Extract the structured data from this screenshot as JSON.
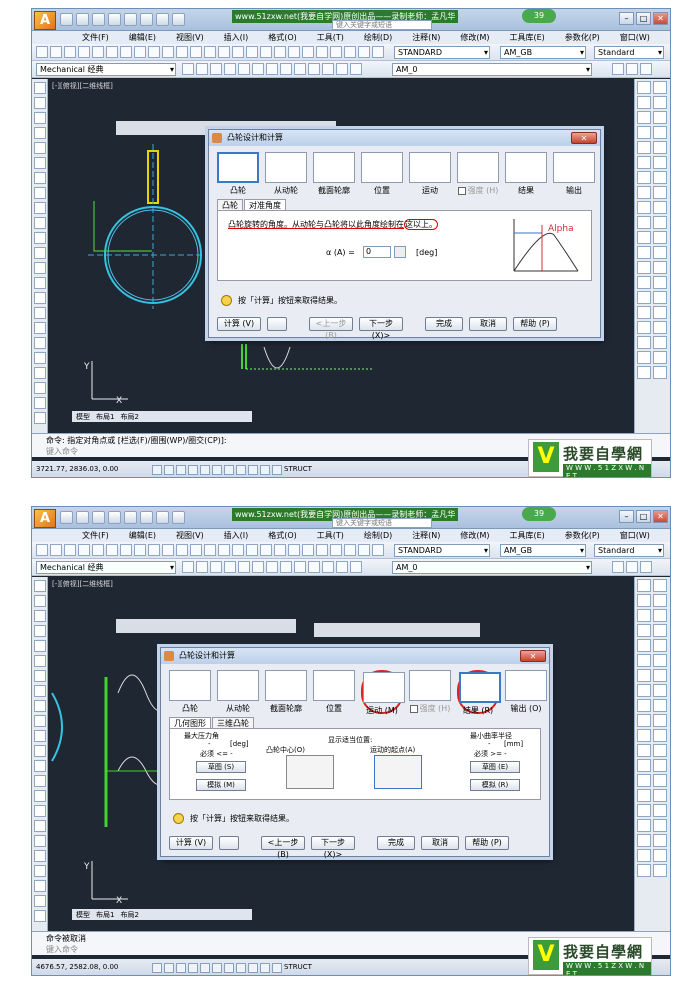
{
  "app": {
    "title_watermark": "www.51zxw.net(我要自学网)原创出品——录制老师：孟凡华",
    "search_placeholder": "键入关键字或短语",
    "badge": "39",
    "help": "?",
    "menu": [
      "文件(F)",
      "编辑(E)",
      "视图(V)",
      "插入(I)",
      "格式(O)",
      "工具(T)",
      "绘制(D)",
      "注释(N)",
      "修改(M)",
      "工具库(E)",
      "参数化(P)",
      "窗口(W)"
    ],
    "style_combo": "STANDARD",
    "dim_combo": "AM_GB",
    "table_combo": "Standard",
    "workspace": "Mechanical 经典",
    "layer": "AM_0",
    "viewport_label": "[-][俯视][二维线框]",
    "layout_tabs": [
      "模型",
      "布局1",
      "布局2"
    ],
    "status_snap": "STRUCT",
    "brand_name": "我要自學網",
    "brand_url": "W W W . 5 1 Z X W . N E T"
  },
  "shot1": {
    "command": "命令: 指定对角点或 [栏选(F)/圈围(WP)/圈交(CP)]:",
    "prompt": "键入命令",
    "coords": "3721.77, 2836.03, 0.00",
    "graph_label": "Alpha"
  },
  "shot2": {
    "command": "命令被取消",
    "prompt": "键入命令",
    "coords": "4676.57, 2582.08, 0.00"
  },
  "dialog": {
    "title": "凸轮设计和计算",
    "close": "✕",
    "wizard": [
      "凸轮",
      "从动轮",
      "截面轮廓",
      "位置",
      "运动",
      "强度 (H)",
      "结果",
      "输出"
    ],
    "wizard_shot2": [
      "凸轮",
      "从动轮",
      "截面轮廓",
      "位置",
      "运动 (M)",
      "强度 (H)",
      "结果 (R)",
      "输出 (O)"
    ],
    "hint": "按「计算」按钮来取得结果。",
    "buttons": [
      "计算 (V)",
      "<上一步 (B)",
      "下一步 (X)>",
      "完成",
      "取消",
      "帮助 (P)"
    ],
    "buttons_shot2": [
      "计算 (V)",
      "<上一步 (B)",
      "下一步 (X)>",
      "完成",
      "取消",
      "帮助 (P)"
    ],
    "shot1_tabs": [
      "凸轮",
      "对准角度"
    ],
    "shot1_desc_a": "凸轮旋转的角度。",
    "shot1_desc_b": "从动轮与凸轮将以此角度绘制在",
    "shot1_desc_c": "这以上。",
    "alpha_label": "α (A) =",
    "alpha_value": "0",
    "alpha_unit": "[deg]",
    "shot2_tabs": [
      "几何图形",
      "三维凸轮"
    ],
    "max_pressure": "最大压力角",
    "min_radius": "最小曲率半径",
    "deg_unit": "[deg]",
    "mm_unit": "[mm]",
    "dash": "-",
    "must_le": "必须 <= -",
    "must_ge": "必须 >= -",
    "show_pos": "显示适当位置:",
    "cam_center": "凸轮中心(O)",
    "motion_start": "运动的起点(A)",
    "sketch": "草图 (S)",
    "sim": "模拟 (M)",
    "sketch2": "草图 (E)",
    "sim2": "模拟 (R)"
  }
}
